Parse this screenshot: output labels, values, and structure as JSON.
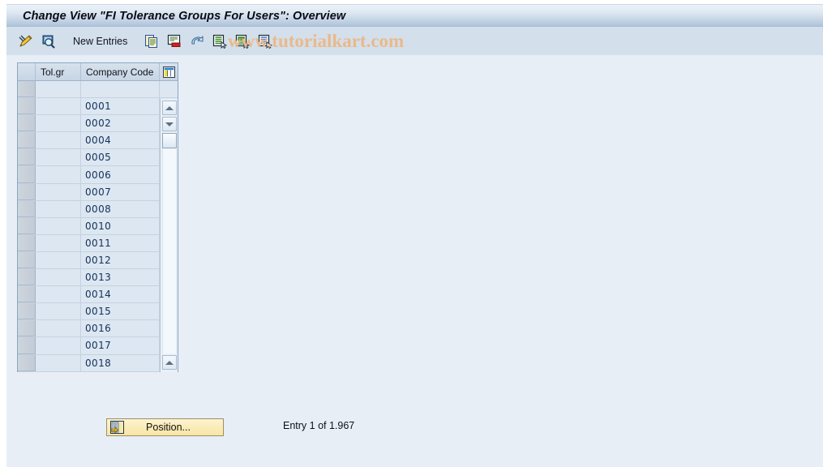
{
  "window": {
    "title": "Change View \"FI Tolerance Groups For Users\": Overview"
  },
  "toolbar": {
    "items": [
      {
        "name": "edit-pencil-icon",
        "label": "",
        "icon": "pencil-icon"
      },
      {
        "name": "display-magnifier-icon",
        "label": "",
        "icon": "magnifier-icon"
      },
      {
        "name": "new-entries-button",
        "label": "New Entries",
        "icon": ""
      },
      {
        "name": "copy-as-icon",
        "label": "",
        "icon": "copy-icon"
      },
      {
        "name": "delete-icon",
        "label": "",
        "icon": "delete-icon"
      },
      {
        "name": "undo-icon",
        "label": "",
        "icon": "undo-arrow-icon"
      },
      {
        "name": "select-all-icon",
        "label": "",
        "icon": "select-all-icon"
      },
      {
        "name": "select-block-icon",
        "label": "",
        "icon": "select-block-icon"
      },
      {
        "name": "deselect-all-icon",
        "label": "",
        "icon": "deselect-icon"
      }
    ],
    "new_entries_label": "New Entries"
  },
  "watermark": {
    "text": "www.tutorialkart.com",
    "color": "#eab98a"
  },
  "table": {
    "columns": [
      {
        "key": "select",
        "label": ""
      },
      {
        "key": "tol_gr",
        "label": "Tol.gr"
      },
      {
        "key": "company_code",
        "label": "Company Code"
      }
    ],
    "config_icon": "table-settings-icon",
    "rows": [
      {
        "tol_gr": "",
        "company_code": ""
      },
      {
        "tol_gr": "",
        "company_code": "0001"
      },
      {
        "tol_gr": "",
        "company_code": "0002"
      },
      {
        "tol_gr": "",
        "company_code": "0004"
      },
      {
        "tol_gr": "",
        "company_code": "0005"
      },
      {
        "tol_gr": "",
        "company_code": "0006"
      },
      {
        "tol_gr": "",
        "company_code": "0007"
      },
      {
        "tol_gr": "",
        "company_code": "0008"
      },
      {
        "tol_gr": "",
        "company_code": "0010"
      },
      {
        "tol_gr": "",
        "company_code": "0011"
      },
      {
        "tol_gr": "",
        "company_code": "0012"
      },
      {
        "tol_gr": "",
        "company_code": "0013"
      },
      {
        "tol_gr": "",
        "company_code": "0014"
      },
      {
        "tol_gr": "",
        "company_code": "0015"
      },
      {
        "tol_gr": "",
        "company_code": "0016"
      },
      {
        "tol_gr": "",
        "company_code": "0017"
      },
      {
        "tol_gr": "",
        "company_code": "0018"
      }
    ]
  },
  "footer": {
    "position_button_label": "Position...",
    "entry_status": "Entry 1 of 1.967"
  }
}
